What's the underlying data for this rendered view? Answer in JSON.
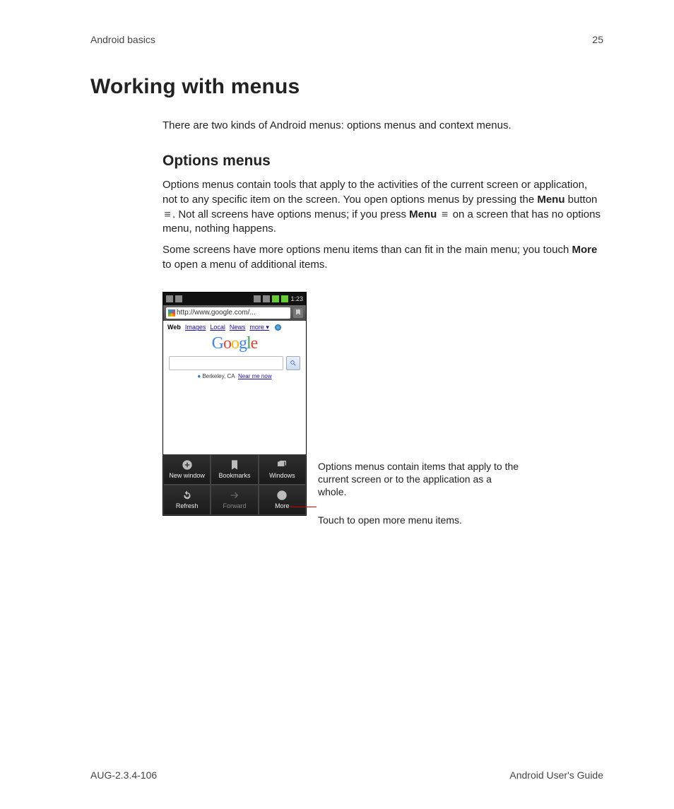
{
  "header": {
    "section": "Android basics",
    "page_no": "25"
  },
  "title": "Working with menus",
  "intro": "There are two kinds of Android menus: options menus and context menus.",
  "subhead": "Options menus",
  "para1": {
    "a": "Options menus contain tools that apply to the activities of the current screen or application, not to any specific item on the screen. You open options menus by pressing the ",
    "menu1": "Menu",
    "b": " button ",
    "c": ". Not all screens have options menus; if you press ",
    "menu2": "Menu",
    "d": " on a screen that has no options menu, nothing happens."
  },
  "para2": {
    "a": "Some screens have more options menu items than can fit in the main menu; you touch ",
    "more": "More",
    "b": " to open a menu of additional items."
  },
  "phone": {
    "time": "1:23",
    "url": "http://www.google.com/...",
    "tabs": {
      "web": "Web",
      "images": "Images",
      "local": "Local",
      "news": "News",
      "more": "more ▾"
    },
    "logo": {
      "g1": "G",
      "o1": "o",
      "o2": "o",
      "g2": "g",
      "l": "l",
      "e": "e"
    },
    "location": "Berkeley, CA",
    "near": "Near me now",
    "menu": {
      "new_window": "New window",
      "bookmarks": "Bookmarks",
      "windows": "Windows",
      "refresh": "Refresh",
      "forward": "Forward",
      "more": "More"
    }
  },
  "annotations": {
    "a1": "Options menus contain items that apply to the current screen or to the application as a whole.",
    "a2": "Touch to open more menu items."
  },
  "footer": {
    "left": "AUG-2.3.4-106",
    "right": "Android User's Guide"
  }
}
